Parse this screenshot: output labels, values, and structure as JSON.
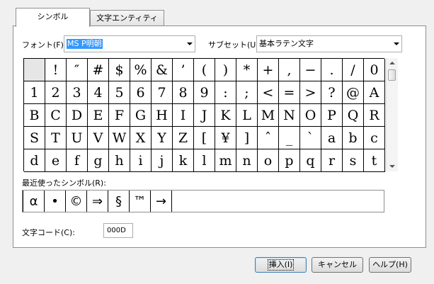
{
  "tabs": [
    {
      "label": "シンボル",
      "active": true
    },
    {
      "label": "文字エンティティ",
      "active": false
    }
  ],
  "font": {
    "label": "フォント(F):",
    "value": "MS P明朝"
  },
  "subset": {
    "label": "サブセット(U):",
    "value": "基本ラテン文字"
  },
  "symbols": [
    " ",
    "!",
    "″",
    "#",
    "$",
    "%",
    "&",
    "’",
    "(",
    ")",
    "*",
    "+",
    ",",
    "−",
    ".",
    "/",
    "0",
    "1",
    "2",
    "3",
    "4",
    "5",
    "6",
    "7",
    "8",
    "9",
    ":",
    ";",
    "<",
    "=",
    ">",
    "?",
    "@",
    "A",
    "B",
    "C",
    "D",
    "E",
    "F",
    "G",
    "H",
    "I",
    "J",
    "K",
    "L",
    "M",
    "N",
    "O",
    "P",
    "Q",
    "R",
    "S",
    "T",
    "U",
    "V",
    "W",
    "X",
    "Y",
    "Z",
    "[",
    "¥",
    "]",
    "ˆ",
    "_",
    "ˋ",
    "a",
    "b",
    "c",
    "d",
    "e",
    "f",
    "g",
    "h",
    "i",
    "j",
    "k",
    "l",
    "m",
    "n",
    "o",
    "p",
    "q",
    "r",
    "s",
    "t"
  ],
  "selected_symbol_index": 0,
  "recent": {
    "label": "最近使ったシンボル(R):",
    "symbols": [
      "α",
      "•",
      "©",
      "⇒",
      "§",
      "™",
      "→"
    ]
  },
  "char_code": {
    "label": "文字コード(C):",
    "value": "000D"
  },
  "buttons": {
    "insert": "挿入(I)",
    "cancel": "キャンセル",
    "help": "ヘルプ(H)"
  },
  "colors": {
    "accent": "#3399ff",
    "panel_border": "#8e8f8f"
  }
}
